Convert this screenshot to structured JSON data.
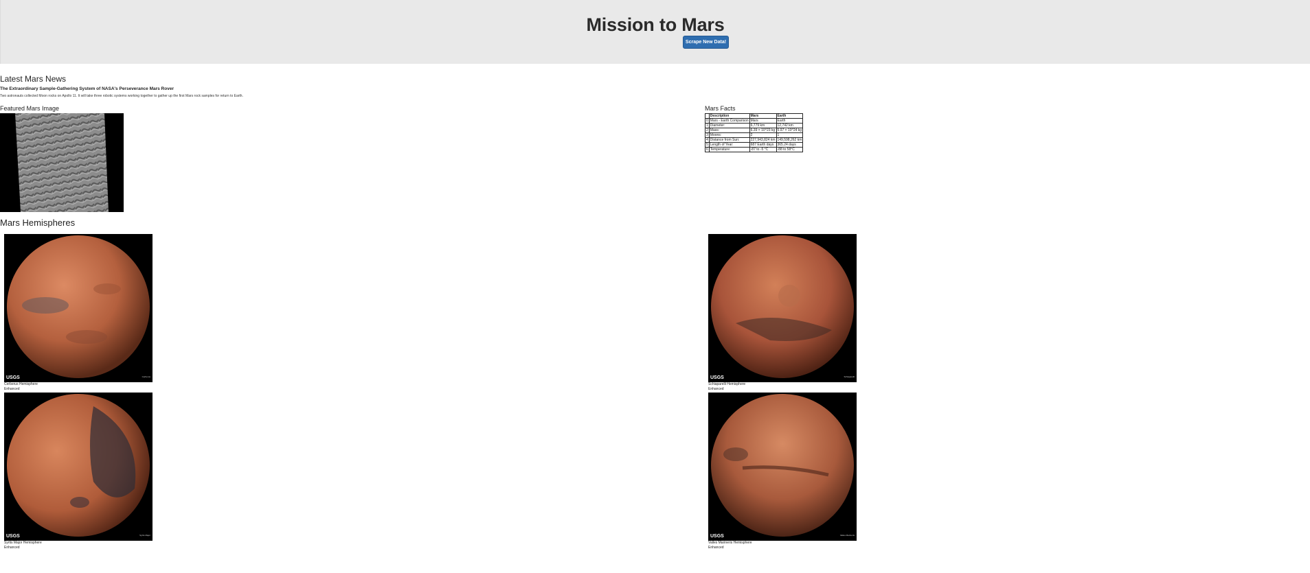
{
  "header": {
    "title": "Mission to Mars",
    "button_label": "Scrape New Data!"
  },
  "news": {
    "heading": "Latest Mars News",
    "title": "The Extraordinary Sample-Gathering System of NASA's Perseverance Mars Rover",
    "paragraph": "Two astronauts collected Moon rocks on Apollo 11. It will take three robotic systems working together to gather up the first Mars rock samples for return to Earth."
  },
  "featured": {
    "heading": "Featured Mars Image"
  },
  "facts": {
    "heading": "Mars Facts",
    "columns": [
      "Description",
      "Mars",
      "Earth"
    ],
    "rows": [
      {
        "idx": "0",
        "description": "Mars - Earth Comparison",
        "mars": "Mars",
        "earth": "Earth"
      },
      {
        "idx": "1",
        "description": "Diameter:",
        "mars": "6,779 km",
        "earth": "12,742 km"
      },
      {
        "idx": "2",
        "description": "Mass:",
        "mars": "6.39 × 10^23 kg",
        "earth": "5.97 × 10^24 kg"
      },
      {
        "idx": "3",
        "description": "Moons:",
        "mars": "2",
        "earth": "1"
      },
      {
        "idx": "4",
        "description": "Distance from Sun:",
        "mars": "227,943,824 km",
        "earth": "149,598,262 km"
      },
      {
        "idx": "5",
        "description": "Length of Year:",
        "mars": "687 Earth days",
        "earth": "365.24 days"
      },
      {
        "idx": "6",
        "description": "Temperature:",
        "mars": "-87 to -5 °C",
        "earth": "-88 to 58°C"
      }
    ]
  },
  "hemispheres": {
    "heading": "Mars Hemispheres",
    "items": [
      {
        "title": "Cerberus Hemisphere",
        "subtitle": "Enhanced",
        "logo": "USGS",
        "label": "Cerberus"
      },
      {
        "title": "Schiaparelli Hemisphere",
        "subtitle": "Enhanced",
        "logo": "USGS",
        "label": "Schiaparelli"
      },
      {
        "title": "Syrtis Major Hemisphere",
        "subtitle": "Enhanced",
        "logo": "USGS",
        "label": "Syrtis Major"
      },
      {
        "title": "Valles Marineris Hemisphere",
        "subtitle": "Enhanced",
        "logo": "USGS",
        "label": "Valles Marineris"
      }
    ]
  },
  "colors": {
    "jumbotron_bg": "#e9e9e9",
    "button_bg": "#2f6eb0",
    "mars_base": "#c0623d"
  }
}
